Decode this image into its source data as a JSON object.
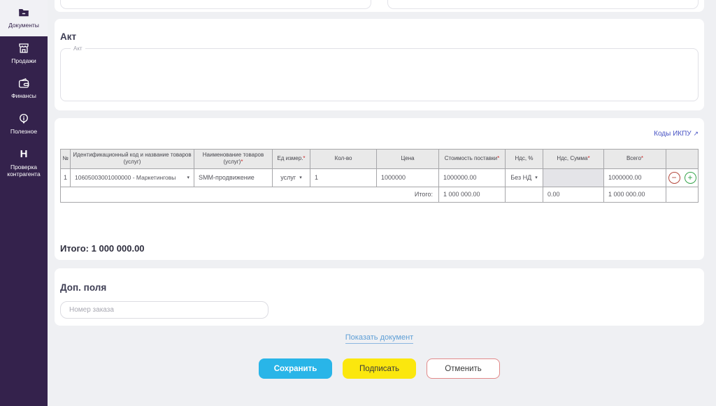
{
  "colors": {
    "sidebar_bg": "#34224c",
    "sidebar_active_bg": "#f1f1f5",
    "page_bg": "#eff0f3",
    "save_button": "#29b5e8",
    "sign_button": "#fbe70e",
    "cancel_border": "#e28989",
    "ikpu_link": "#4853c4",
    "show_document_link": "#5f9fd6",
    "minus_button": "#b4483c",
    "plus_button": "#35a34a",
    "table_header_bg": "#e9e9e9",
    "required_mark_color": "#cc2b2b"
  },
  "icons": {
    "dropdown_caret": "▾",
    "external_link": "↗",
    "minus": "−",
    "plus": "+",
    "counterparty_letter": "H"
  },
  "sidebar": {
    "items": [
      {
        "label": "Документы",
        "icon": "documents-icon",
        "active": true
      },
      {
        "label": "Продажи",
        "icon": "sales-icon",
        "active": false
      },
      {
        "label": "Финансы",
        "icon": "finance-icon",
        "active": false
      },
      {
        "label": "Полезное",
        "icon": "useful-icon",
        "active": false
      },
      {
        "label": "Проверка контрагента",
        "icon": "counterparty-check-icon",
        "active": false
      }
    ]
  },
  "act": {
    "title": "Акт",
    "field_label": "Акт",
    "value": ""
  },
  "items_table": {
    "ikpu_link_label": "Коды ИКПУ",
    "required_mark": "*",
    "headers": {
      "num": "№",
      "code": "Идентификационный код и название товаров (услуг)",
      "name": "Наименование товаров (услуг)",
      "unit": "Ед измер.",
      "qty": "Кол-во",
      "price": "Цена",
      "supply_cost": "Стоимость поставки",
      "vat_percent": "Ндс, %",
      "vat_sum": "Ндс, Сумма",
      "total": "Всего"
    },
    "row": {
      "num": "1",
      "code": "10605003001000000 - Маркетинговы",
      "name": "SMM-продвижение",
      "unit": "услуг",
      "qty": "1",
      "price": "1000000",
      "supply_cost": "1000000.00",
      "vat_percent": "Без НД",
      "vat_sum": "",
      "total": "1000000.00"
    },
    "totals_row": {
      "label": "Итого:",
      "supply_cost": "1 000 000.00",
      "vat_sum": "0.00",
      "total": "1 000 000.00"
    },
    "grand_total": {
      "label": "Итого:",
      "value": "1 000 000.00"
    }
  },
  "extra_fields": {
    "title": "Доп. поля",
    "order_placeholder": "Номер заказа"
  },
  "footer": {
    "show_document": "Показать документ",
    "save": "Сохранить",
    "sign": "Подписать",
    "cancel": "Отменить"
  }
}
